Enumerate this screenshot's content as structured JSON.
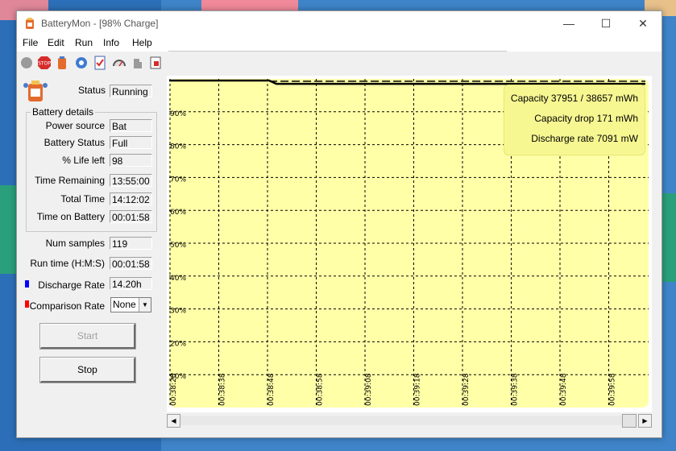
{
  "window": {
    "title": "BatteryMon - [98% Charge]"
  },
  "titlebar": {
    "minimize": "—",
    "maximize": "☐",
    "close": "✕"
  },
  "menu": [
    "File",
    "Edit",
    "Run",
    "Info",
    "Help"
  ],
  "toolbar": [
    "record-icon",
    "stop-icon",
    "battery-icon",
    "settings-icon",
    "checklist-icon",
    "gauge-icon",
    "puzzle-icon",
    "log-icon"
  ],
  "status": {
    "label": "Status",
    "value": "Running"
  },
  "battery_details": {
    "title": "Battery details",
    "rows": [
      {
        "label": "Power source",
        "value": "Bat"
      },
      {
        "label": "Battery Status",
        "value": "Full"
      },
      {
        "label": "% Life left",
        "value": "98"
      },
      {
        "label": "Time Remaining",
        "value": "13:55:00"
      },
      {
        "label": "Total Time",
        "value": "14:12:02"
      },
      {
        "label": "Time on Battery",
        "value": "00:01:58"
      }
    ]
  },
  "stats": {
    "num_samples": {
      "label": "Num samples",
      "value": "119"
    },
    "run_time": {
      "label": "Run time (H:M:S)",
      "value": "00:01:58"
    },
    "discharge_rate": {
      "label": "Discharge Rate",
      "value": "14.20h",
      "color": "#0000ff"
    },
    "comparison_rate": {
      "label": "Comparison Rate",
      "value": "None",
      "color": "#ff0000"
    }
  },
  "buttons": {
    "start": "Start",
    "stop": "Stop"
  },
  "info_box": {
    "capacity": "Capacity 37951 / 38657 mWh",
    "capacity_drop": "Capacity drop 171 mWh",
    "discharge_rate": "Discharge rate 7091 mW"
  },
  "chart_data": {
    "type": "line",
    "y_ticks": [
      "90%",
      "80%",
      "70%",
      "60%",
      "50%",
      "40%",
      "30%",
      "20%",
      "10%"
    ],
    "x_ticks": [
      "00:38:28",
      "00:38:38",
      "00:38:48",
      "00:38:58",
      "00:39:08",
      "00:39:18",
      "00:39:28",
      "00:39:38",
      "00:39:48",
      "00:39:58"
    ],
    "ylim": [
      0,
      100
    ],
    "background": "#ffffa8",
    "series": [
      {
        "style": "solid",
        "color": "#000000",
        "points": [
          [
            0,
            99.5
          ],
          [
            0.21,
            99.5
          ],
          [
            0.225,
            98.5
          ],
          [
            1.0,
            98.5
          ]
        ]
      },
      {
        "style": "dashed",
        "color": "#000000",
        "points": [
          [
            0.21,
            99.3
          ],
          [
            1.0,
            99.3
          ]
        ]
      }
    ]
  }
}
